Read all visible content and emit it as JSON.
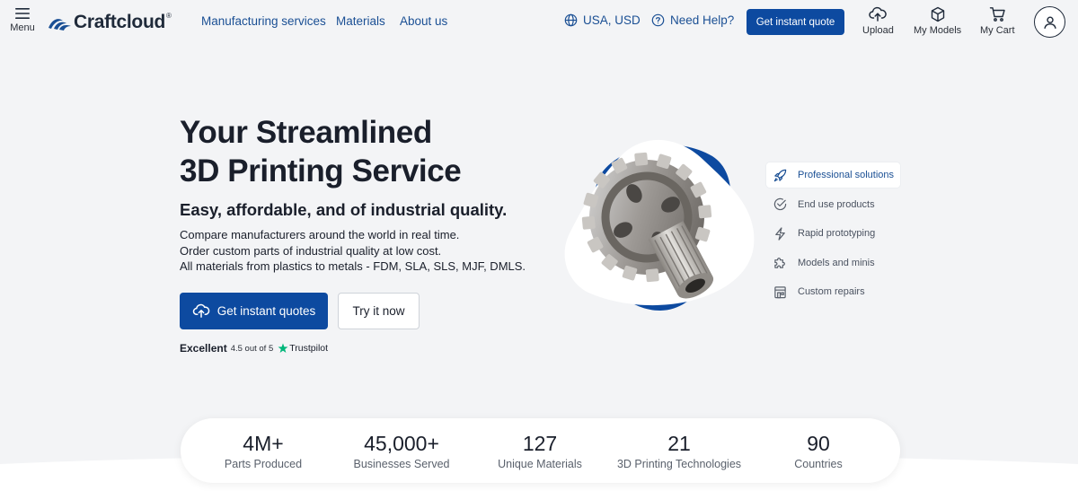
{
  "header": {
    "menu_label": "Menu",
    "logo_text": "Craftcloud",
    "logo_mark": "®",
    "nav": [
      {
        "label": "Manufacturing services"
      },
      {
        "label": "Materials"
      },
      {
        "label": "About us"
      }
    ],
    "region_label": "USA, USD",
    "help_label": "Need Help?",
    "cta_label": "Get instant quote",
    "upload_label": "Upload",
    "models_label": "My Models",
    "cart_label": "My Cart"
  },
  "hero": {
    "title_line1": "Your Streamlined",
    "title_line2": "3D Printing Service",
    "subtitle": "Easy, affordable, and of industrial quality.",
    "desc": [
      "Compare manufacturers around the world in real time.",
      "Order custom parts of industrial quality at low cost.",
      "All materials from plastics to metals - FDM, SLA, SLS, MJF, DMLS."
    ],
    "primary_button": "Get instant quotes",
    "secondary_button": "Try it now",
    "rating": {
      "label": "Excellent",
      "score": "4.5 out of 5",
      "brand": "Trustpilot"
    }
  },
  "features": [
    {
      "label": "Professional solutions",
      "icon": "rocket-icon",
      "active": true
    },
    {
      "label": "End use products",
      "icon": "check-circle-icon",
      "active": false
    },
    {
      "label": "Rapid prototyping",
      "icon": "lightning-icon",
      "active": false
    },
    {
      "label": "Models and minis",
      "icon": "puzzle-icon",
      "active": false
    },
    {
      "label": "Custom repairs",
      "icon": "storefront-icon",
      "active": false
    }
  ],
  "stats": [
    {
      "value": "4M+",
      "label": "Parts Produced"
    },
    {
      "value": "45,000+",
      "label": "Businesses Served"
    },
    {
      "value": "127",
      "label": "Unique Materials"
    },
    {
      "value": "21",
      "label": "3D Printing Technologies"
    },
    {
      "value": "90",
      "label": "Countries"
    }
  ],
  "colors": {
    "brand_blue": "#0d4aa0",
    "link_blue": "#1a4f94",
    "background": "#f3f4f6",
    "trustpilot_green": "#00b67a"
  }
}
